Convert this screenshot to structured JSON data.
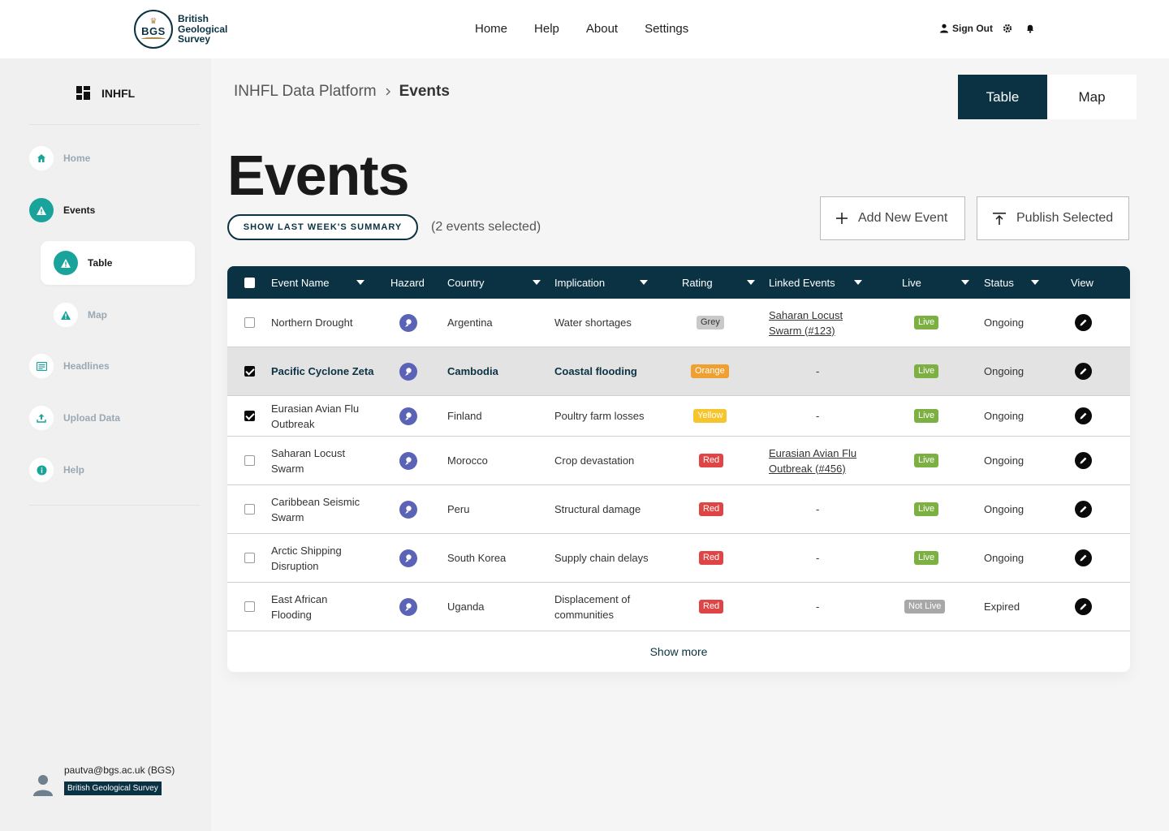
{
  "header": {
    "logo_abbr": "BGS",
    "logo_line1": "British",
    "logo_line2": "Geological",
    "logo_line3": "Survey",
    "nav": [
      "Home",
      "Help",
      "About",
      "Settings"
    ],
    "sign_out": "Sign Out"
  },
  "sidebar": {
    "brand": "INHFL",
    "items": [
      {
        "label": "Home",
        "icon": "home-icon"
      },
      {
        "label": "Events",
        "icon": "warning-icon"
      },
      {
        "label": "Table",
        "icon": "warning-icon"
      },
      {
        "label": "Map",
        "icon": "warning-icon"
      },
      {
        "label": "Headlines",
        "icon": "newspaper-icon"
      },
      {
        "label": "Upload Data",
        "icon": "upload-icon"
      },
      {
        "label": "Help",
        "icon": "info-icon"
      }
    ],
    "user_email": "pautva@bgs.ac.uk (BGS)",
    "user_org": "British Geological Survey"
  },
  "main": {
    "breadcrumb_root": "INHFL Data Platform",
    "breadcrumb_current": "Events",
    "view_table": "Table",
    "view_map": "Map",
    "title": "Events",
    "summary_button": "SHOW LAST WEEK'S SUMMARY",
    "selected_count": "(2 events selected)",
    "add_button": "Add New Event",
    "publish_button": "Publish Selected",
    "show_more": "Show more"
  },
  "table": {
    "columns": [
      "Event Name",
      "Hazard",
      "Country",
      "Implication",
      "Rating",
      "Linked Events",
      "Live",
      "Status",
      "View"
    ],
    "rows": [
      {
        "name": "Northern Drought",
        "country": "Argentina",
        "implication": "Water shortages",
        "rating": "Grey",
        "linked": "Saharan Locust Swarm (#123)",
        "live": "Live",
        "status": "Ongoing"
      },
      {
        "name": "Pacific Cyclone Zeta",
        "country": "Cambodia",
        "implication": "Coastal flooding",
        "rating": "Orange",
        "linked": "-",
        "live": "Live",
        "status": "Ongoing"
      },
      {
        "name": "Eurasian Avian Flu Outbreak",
        "country": "Finland",
        "implication": "Poultry farm losses",
        "rating": "Yellow",
        "linked": "-",
        "live": "Live",
        "status": "Ongoing"
      },
      {
        "name": "Saharan Locust Swarm",
        "country": "Morocco",
        "implication": "Crop devastation",
        "rating": "Red",
        "linked": "Eurasian Avian Flu Outbreak (#456)",
        "live": "Live",
        "status": "Ongoing"
      },
      {
        "name": "Caribbean Seismic Swarm",
        "country": "Peru",
        "implication": "Structural damage",
        "rating": "Red",
        "linked": "-",
        "live": "Live",
        "status": "Ongoing"
      },
      {
        "name": "Arctic Shipping Disruption",
        "country": "South Korea",
        "implication": "Supply chain delays",
        "rating": "Red",
        "linked": "-",
        "live": "Live",
        "status": "Ongoing"
      },
      {
        "name": "East African Flooding",
        "country": "Uganda",
        "implication": "Displacement of communities",
        "rating": "Red",
        "linked": "-",
        "live": "Not Live",
        "status": "Expired"
      }
    ]
  },
  "colors": {
    "primary": "#0a3243",
    "accent": "#1aa39b",
    "hazard": "#5a63b5"
  }
}
